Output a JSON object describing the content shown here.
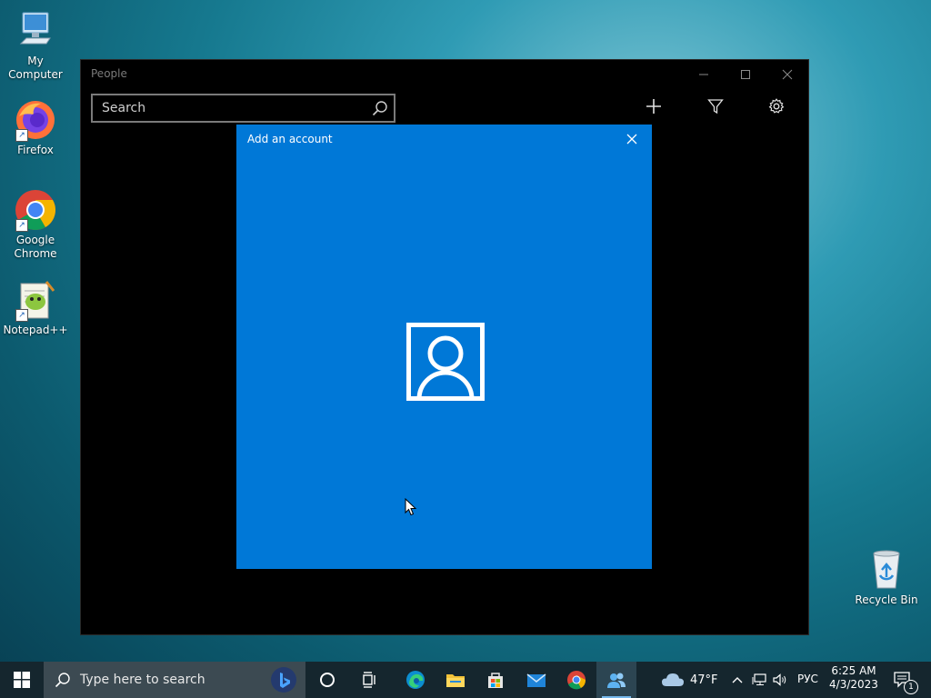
{
  "desktop": {
    "icons": [
      {
        "label": "My Computer"
      },
      {
        "label": "Firefox"
      },
      {
        "label": "Google Chrome"
      },
      {
        "label": "Notepad++"
      },
      {
        "label": "Recycle Bin"
      }
    ]
  },
  "window": {
    "title": "People",
    "search": {
      "placeholder": "Search",
      "value": ""
    },
    "toolbar": {
      "add_icon": "plus-icon",
      "filter_icon": "filter-icon",
      "settings_icon": "gear-icon"
    }
  },
  "dialog": {
    "title": "Add an account",
    "icon": "person-account-icon",
    "background": "#0078d7"
  },
  "taskbar": {
    "search_placeholder": "Type here to search",
    "weather": {
      "temp": "47°F"
    },
    "language": "РУС",
    "time": "6:25 AM",
    "date": "4/3/2023",
    "notification_count": "1"
  }
}
